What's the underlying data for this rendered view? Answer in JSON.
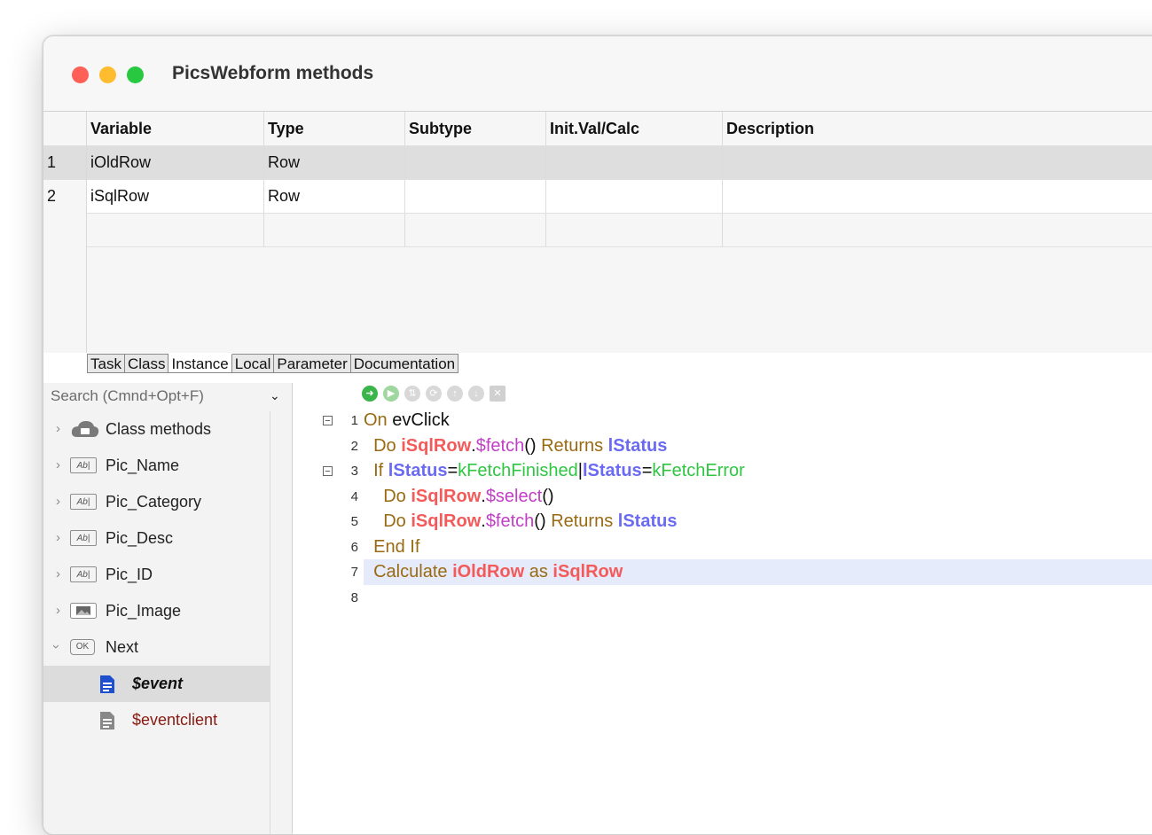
{
  "window": {
    "title": "PicsWebform methods"
  },
  "grid": {
    "headers": [
      "Variable",
      "Type",
      "Subtype",
      "Init.Val/Calc",
      "Description"
    ],
    "rows": [
      {
        "num": "1",
        "variable": "iOldRow",
        "type": "Row",
        "subtype": "",
        "init": "",
        "description": ""
      },
      {
        "num": "2",
        "variable": "iSqlRow",
        "type": "Row",
        "subtype": "",
        "init": "",
        "description": ""
      }
    ]
  },
  "tabs": [
    "Task",
    "Class",
    "Instance",
    "Local",
    "Parameter",
    "Documentation"
  ],
  "active_tab": "Instance",
  "sidebar": {
    "search_placeholder": "Search (Cmnd+Opt+F)",
    "items": [
      {
        "label": "Class methods",
        "icon": "cloud-folder-icon"
      },
      {
        "label": "Pic_Name",
        "icon": "field-icon"
      },
      {
        "label": "Pic_Category",
        "icon": "field-icon"
      },
      {
        "label": "Pic_Desc",
        "icon": "field-icon"
      },
      {
        "label": "Pic_ID",
        "icon": "field-icon"
      },
      {
        "label": "Pic_Image",
        "icon": "picture-field-icon"
      },
      {
        "label": "Next",
        "icon": "ok-button-icon"
      },
      {
        "label": "$event",
        "icon": "document-icon"
      },
      {
        "label": "$eventclient",
        "icon": "document-icon"
      }
    ],
    "field_icon_text": "Ab|",
    "ok_icon_text": "OK"
  },
  "editor": {
    "line_numbers": [
      "1",
      "2",
      "3",
      "4",
      "5",
      "6",
      "7",
      "8"
    ],
    "lines": [
      [
        {
          "t": "On ",
          "c": "kw"
        },
        {
          "t": "evClick",
          "c": "plain"
        }
      ],
      [
        {
          "t": "  Do ",
          "c": "kw"
        },
        {
          "t": "iSqlRow",
          "c": "var"
        },
        {
          "t": ".",
          "c": "plain"
        },
        {
          "t": "$fetch",
          "c": "meth"
        },
        {
          "t": "() ",
          "c": "plain"
        },
        {
          "t": "Returns ",
          "c": "kw"
        },
        {
          "t": "lStatus",
          "c": "lvar"
        }
      ],
      [
        {
          "t": "  If ",
          "c": "kw"
        },
        {
          "t": "lStatus",
          "c": "lvar"
        },
        {
          "t": "=",
          "c": "plain"
        },
        {
          "t": "kFetchFinished",
          "c": "const"
        },
        {
          "t": "|",
          "c": "plain"
        },
        {
          "t": "lStatus",
          "c": "lvar"
        },
        {
          "t": "=",
          "c": "plain"
        },
        {
          "t": "kFetchError",
          "c": "const"
        }
      ],
      [
        {
          "t": "    Do ",
          "c": "kw"
        },
        {
          "t": "iSqlRow",
          "c": "var"
        },
        {
          "t": ".",
          "c": "plain"
        },
        {
          "t": "$select",
          "c": "meth"
        },
        {
          "t": "()",
          "c": "plain"
        }
      ],
      [
        {
          "t": "    Do ",
          "c": "kw"
        },
        {
          "t": "iSqlRow",
          "c": "var"
        },
        {
          "t": ".",
          "c": "plain"
        },
        {
          "t": "$fetch",
          "c": "meth"
        },
        {
          "t": "() ",
          "c": "plain"
        },
        {
          "t": "Returns ",
          "c": "kw"
        },
        {
          "t": "lStatus",
          "c": "lvar"
        }
      ],
      [
        {
          "t": "  End If",
          "c": "kw"
        }
      ],
      [
        {
          "t": "  Calculate ",
          "c": "kw"
        },
        {
          "t": "iOldRow",
          "c": "var"
        },
        {
          "t": " as ",
          "c": "kw"
        },
        {
          "t": "iSqlRow",
          "c": "var"
        }
      ],
      []
    ],
    "highlight_line": 7,
    "fold_lines": [
      1,
      3
    ],
    "colors": {
      "keyword": "#9a6a12",
      "instance_var": "#f35a5a",
      "method": "#c13ec7",
      "local_var": "#6a6af2",
      "constant": "#2fc642",
      "highlight": "#e6ebfb"
    }
  }
}
